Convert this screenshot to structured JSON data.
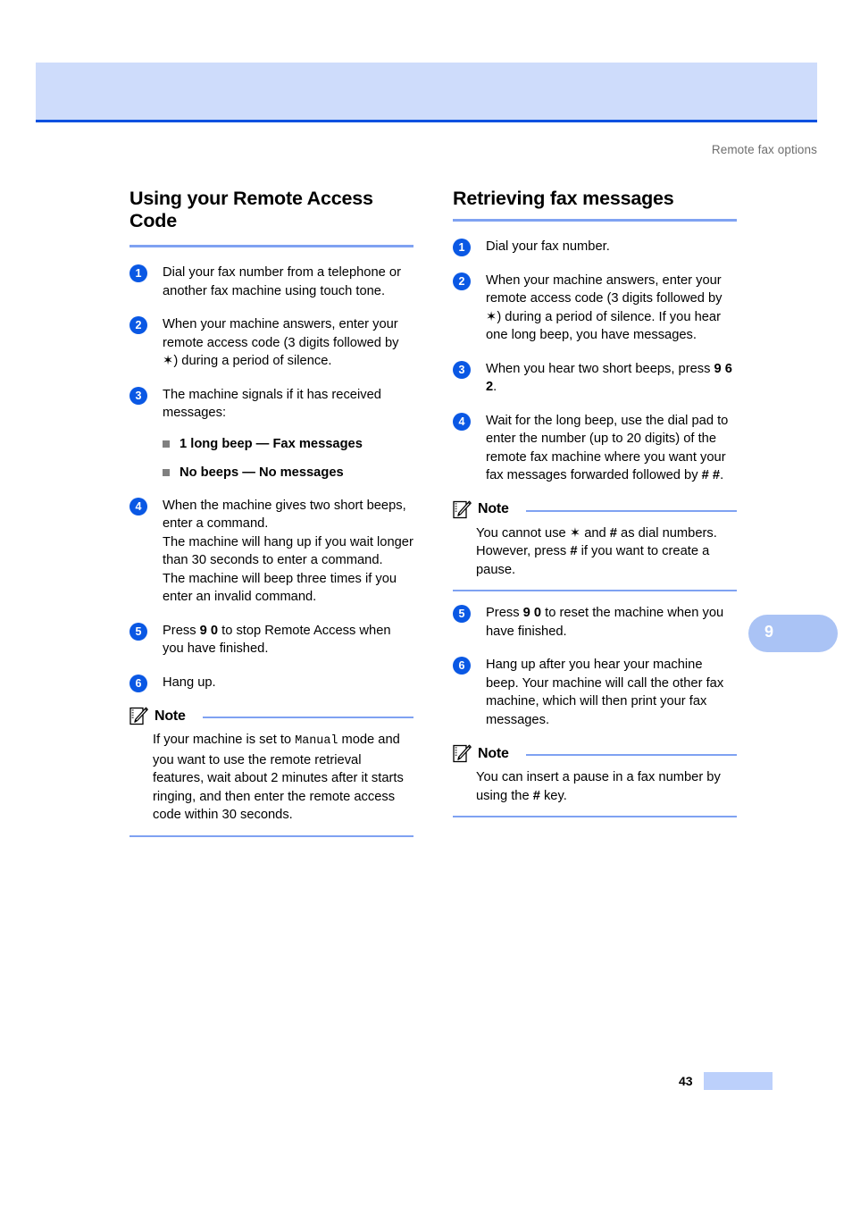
{
  "page": {
    "running_header": "Remote fax options",
    "chapter_tab": "9",
    "page_number": "43",
    "accent_color": "#7fa2f2",
    "banner_color": "#cedcfb",
    "banner_border_color": "#0050e0",
    "step_bullet_color": "#0a58e4",
    "tab_color": "#aac3f5"
  },
  "left_column": {
    "title": "Using your Remote Access Code",
    "steps": [
      {
        "num": "1",
        "text": "Dial your fax number from a telephone or another fax machine using touch tone."
      },
      {
        "num": "2",
        "text_before": "When your machine answers, enter your remote access code (3 digits followed by ",
        "symbol": "✶",
        "text_after": ") during a period of silence."
      },
      {
        "num": "3",
        "text": "The machine signals if it has received messages:",
        "sub_bullets": [
          "1 long beep — Fax messages",
          "No beeps — No messages"
        ]
      },
      {
        "num": "4",
        "text": "When the machine gives two short beeps, enter a command. The machine will hang up if you wait longer than 30 seconds to enter a command. The machine will beep three times if you enter an invalid command.",
        "line1": "When the machine gives two short beeps, enter a command.",
        "line2": "The machine will hang up if you wait longer than 30 seconds to enter a command.",
        "line3": "The machine will beep three times if you enter an invalid command."
      },
      {
        "num": "5",
        "text_before": "Press ",
        "bold": "9 0",
        "text_after": " to stop Remote Access when you have finished."
      },
      {
        "num": "6",
        "text": "Hang up."
      }
    ],
    "note": {
      "label": "Note",
      "text_before": "If your machine is set to ",
      "mono": "Manual",
      "text_after": " mode and you want to use the remote retrieval features, wait about 2 minutes after it starts ringing, and then enter the remote access code within 30 seconds."
    }
  },
  "right_column": {
    "title": "Retrieving fax messages",
    "steps": [
      {
        "num": "1",
        "text": "Dial your fax number."
      },
      {
        "num": "2",
        "text_before": "When your machine answers, enter your remote access code (3 digits followed by ",
        "symbol": "✶",
        "text_after": ") during a period of silence. If you hear one long beep, you have messages."
      },
      {
        "num": "3",
        "text_before": "When you hear two short beeps, press ",
        "bold": "9 6 2",
        "text_after": "."
      },
      {
        "num": "4",
        "text_before": "Wait for the long beep, use the dial pad to enter the number (up to 20 digits) of the remote fax machine where you want your fax messages forwarded followed by ",
        "bold": "# #",
        "text_after": "."
      },
      {
        "num": "5",
        "text_before": "Press ",
        "bold": "9 0",
        "text_after": " to reset the machine when you have finished."
      },
      {
        "num": "6",
        "text": "Hang up after you hear your machine beep. Your machine will call the other fax machine, which will then print your fax messages."
      }
    ],
    "note1": {
      "label": "Note",
      "text_before": "You cannot use ",
      "symbol": "✶",
      "text_mid": " and ",
      "bold1": "#",
      "text_mid2": " as dial numbers. However, press ",
      "bold2": "#",
      "text_after": " if you want to create a pause."
    },
    "note2": {
      "label": "Note",
      "text_before": "You can insert a pause in a fax number by using the ",
      "bold": "#",
      "text_after": " key."
    }
  }
}
